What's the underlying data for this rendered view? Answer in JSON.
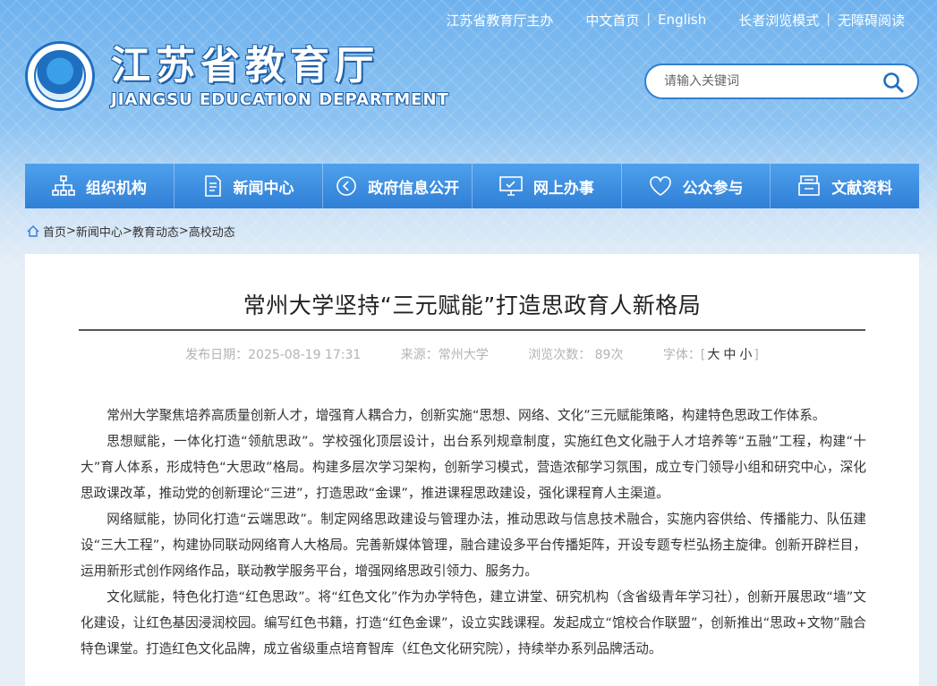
{
  "top_links": {
    "sponsor": "江苏省教育厅主办",
    "home_cn": "中文首页",
    "english": "English",
    "elder_mode": "长者浏览模式",
    "accessible": "无障碍阅读"
  },
  "brand": {
    "name_cn": "江苏省教育厅",
    "name_en": "JIANGSU EDUCATION DEPARTMENT"
  },
  "search": {
    "placeholder": "请输入关键词"
  },
  "nav": [
    {
      "label": "组织机构",
      "icon": "org-chart-icon"
    },
    {
      "label": "新闻中心",
      "icon": "document-icon"
    },
    {
      "label": "政府信息公开",
      "icon": "chevron-circle-icon"
    },
    {
      "label": "网上办事",
      "icon": "monitor-icon"
    },
    {
      "label": "公众参与",
      "icon": "heart-icon"
    },
    {
      "label": "文献资料",
      "icon": "archive-icon"
    }
  ],
  "breadcrumb": [
    "首页",
    "新闻中心",
    "教育动态",
    "高校动态"
  ],
  "article": {
    "title": "常州大学坚持“三元赋能”打造思政育人新格局",
    "date": "发布日期：2025-08-19 17:31",
    "source": "来源：常州大学",
    "views": "浏览次数：  89次",
    "font_label": "字体：",
    "font_large": "大",
    "font_mid": "中",
    "font_small": "小",
    "paragraphs": [
      "常州大学聚焦培养高质量创新人才，增强育人耦合力，创新实施“思想、网络、文化”三元赋能策略，构建特色思政工作体系。",
      "思想赋能，一体化打造“领航思政”。学校强化顶层设计，出台系列规章制度，实施红色文化融于人才培养等“五融”工程，构建“十大”育人体系，形成特色“大思政”格局。构建多层次学习架构，创新学习模式，营造浓郁学习氛围，成立专门领导小组和研究中心，深化思政课改革，推动党的创新理论“三进”，打造思政“金课”，推进课程思政建设，强化课程育人主渠道。",
      "网络赋能，协同化打造“云端思政”。制定网络思政建设与管理办法，推动思政与信息技术融合，实施内容供给、传播能力、队伍建设“三大工程”，构建协同联动网络育人大格局。完善新媒体管理，融合建设多平台传播矩阵，开设专题专栏弘扬主旋律。创新开辟栏目，运用新形式创作网络作品，联动教学服务平台，增强网络思政引领力、服务力。",
      "文化赋能，特色化打造“红色思政”。将“红色文化”作为办学特色，建立讲堂、研究机构（含省级青年学习社），创新开展思政“墙”文化建设，让红色基因浸润校园。编写红色书籍，打造“红色金课”，设立实践课程。发起成立“馆校合作联盟”，创新推出“思政+文物”融合特色课堂。打造红色文化品牌，成立省级重点培育智库（红色文化研究院），持续举办系列品牌活动。"
    ]
  },
  "colors": {
    "nav_top": "#4fa0ec",
    "nav_bottom": "#2f7fd6",
    "brand_blue": "#1f6fc0"
  }
}
